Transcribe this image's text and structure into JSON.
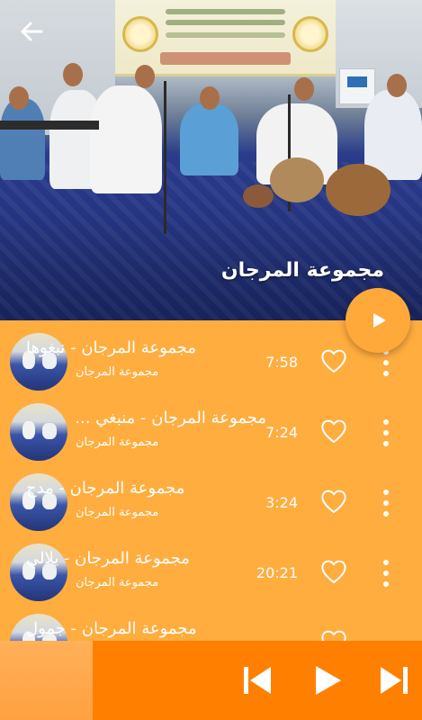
{
  "colors": {
    "accent": "#FFAD3F",
    "player_bar": "#FF7F00",
    "fab": "#FFA93A",
    "text": "#FFFFFF"
  },
  "header": {
    "back_icon": "arrow-left-icon",
    "album_title": "مجموعة المرجان",
    "play_icon": "play-icon"
  },
  "tracks": [
    {
      "title": "مجموعة المرجان - نبغوها",
      "artist": "مجموعة المرجان",
      "duration": "7:58"
    },
    {
      "title": "مجموعة المرجان - منبغي ...",
      "artist": "مجموعة المرجان",
      "duration": "7:24"
    },
    {
      "title": "مجموعة المرجان - مدح",
      "artist": "مجموعة المرجان",
      "duration": "3:24"
    },
    {
      "title": "مجموعة المرجان - يلالي",
      "artist": "مجموعة المرجان",
      "duration": "20:21"
    },
    {
      "title": "مجموعة المرجان - جمول",
      "artist": "",
      "duration": ""
    }
  ],
  "player": {
    "prev_icon": "skip-previous-icon",
    "play_icon": "play-icon",
    "next_icon": "skip-next-icon"
  }
}
